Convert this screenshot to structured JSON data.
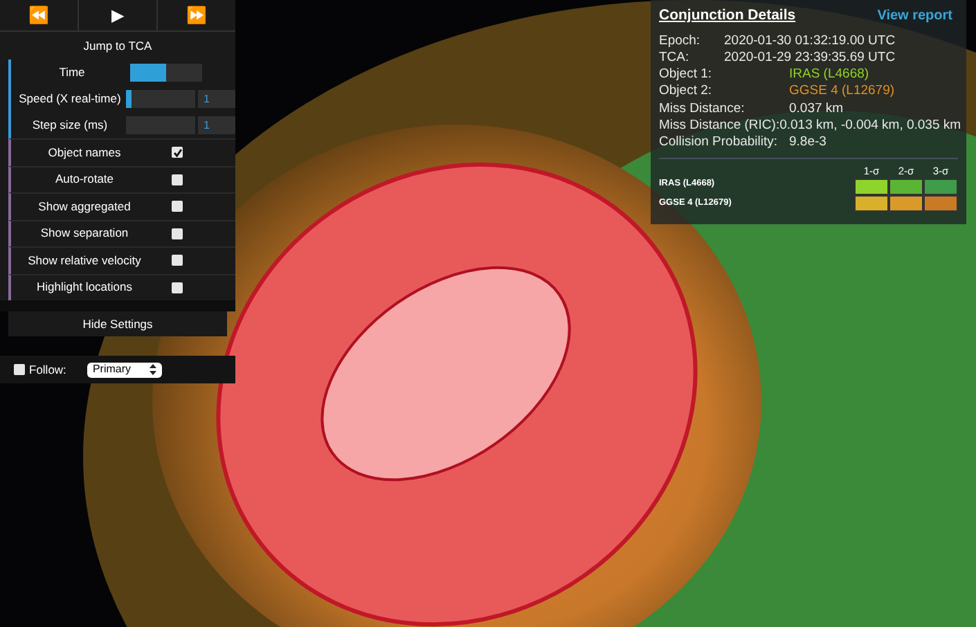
{
  "playback": {
    "buttons": [
      "⏪",
      "▶",
      "⏩"
    ]
  },
  "jump_button": "Jump to TCA",
  "sliders": [
    {
      "label": "Time",
      "level": 0.5
    },
    {
      "label": "Speed (X real-time)",
      "level": 0.08,
      "value": "1"
    },
    {
      "label": "Step size (ms)",
      "level": 0,
      "value": "1"
    }
  ],
  "options": [
    {
      "label": "Object names",
      "checked": true
    },
    {
      "label": "Auto-rotate",
      "checked": false
    },
    {
      "label": "Show aggregated",
      "checked": false
    },
    {
      "label": "Show separation",
      "checked": false
    },
    {
      "label": "Show relative velocity",
      "checked": false
    },
    {
      "label": "Highlight locations",
      "checked": false
    }
  ],
  "hide_settings": "Hide Settings",
  "follow": {
    "checked": false,
    "label": "Follow:",
    "value": "Primary"
  },
  "details": {
    "title": "Conjunction Details",
    "link": "View report",
    "rows": [
      {
        "label": "Epoch:",
        "value": "2020-01-30 01:32:19.00 UTC"
      },
      {
        "label": "TCA:",
        "value": "2020-01-29 23:39:35.69 UTC"
      },
      {
        "label": "Object 1:",
        "value": "IRAS (L4668)",
        "color": "#8fd42a"
      },
      {
        "label": "Object 2:",
        "value": "GGSE 4 (L12679)",
        "color": "#e0902a"
      },
      {
        "label": "Miss Distance:",
        "value": "0.037 km"
      },
      {
        "label": "Miss Distance (RIC):",
        "value": "0.013 km, -0.004 km, 0.035 km"
      },
      {
        "label": "Collision Probability:",
        "value": "9.8e-3"
      }
    ],
    "sigma_headers": [
      "1-σ",
      "2-σ",
      "3-σ"
    ],
    "sigma_rows": [
      {
        "label": "IRAS (L4668)",
        "swatches": [
          {
            "color": "#8fd42a"
          },
          {
            "color": "#5bb535"
          },
          {
            "color": "#3f9c48"
          }
        ]
      },
      {
        "label": "GGSE 4 (L12679)",
        "swatches": [
          {
            "color": "#d8b02a"
          },
          {
            "color": "#d99a2a"
          },
          {
            "color": "#c97a25"
          }
        ]
      }
    ]
  }
}
